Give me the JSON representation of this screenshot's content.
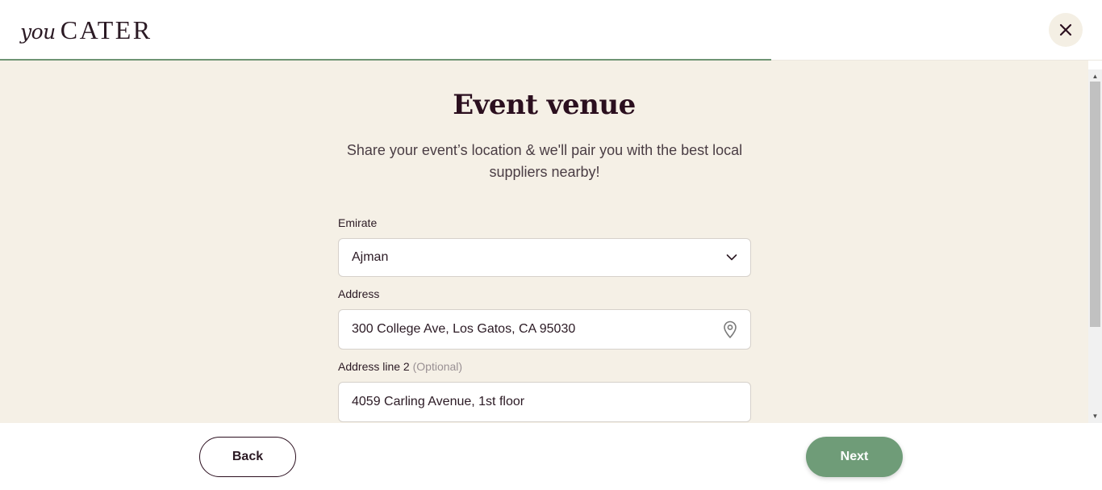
{
  "header": {
    "logo_you": "you",
    "logo_cater": "CATER",
    "close_icon": "close-icon",
    "progress_fraction": 0.7
  },
  "main": {
    "title": "Event venue",
    "subtitle": "Share your event’s location & we'll pair you with the best local suppliers nearby!",
    "fields": {
      "emirate": {
        "label": "Emirate",
        "value": "Ajman",
        "icon": "chevron-down-icon"
      },
      "address": {
        "label": "Address",
        "value": "300 College Ave, Los Gatos, CA 95030",
        "icon": "location-pin-icon"
      },
      "address_line2": {
        "label": "Address line 2",
        "optional": "(Optional)",
        "value": "4059 Carling Avenue, 1st floor"
      }
    }
  },
  "footer": {
    "back_label": "Back",
    "next_label": "Next"
  },
  "colors": {
    "accent": "#6f9c78",
    "background": "#f5f0e6",
    "heading": "#2b0f1f"
  }
}
